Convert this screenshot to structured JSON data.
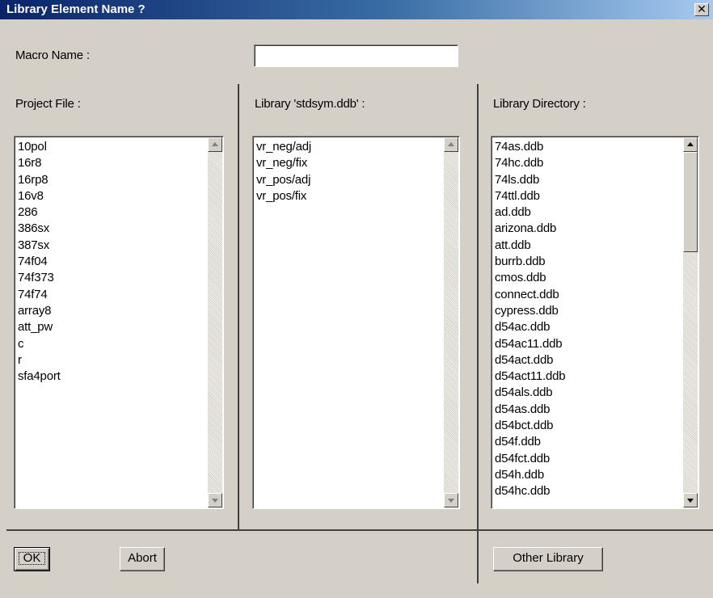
{
  "window": {
    "title": "Library Element Name ?",
    "close_symbol": "✕"
  },
  "macro": {
    "label": "Macro Name :",
    "value": "",
    "placeholder": ""
  },
  "project": {
    "label": "Project File :",
    "items": [
      "10pol",
      "16r8",
      "16rp8",
      "16v8",
      "286",
      "386sx",
      "387sx",
      "74f04",
      "74f373",
      "74f74",
      "array8",
      "att_pw",
      "c",
      "r",
      "sfa4port"
    ]
  },
  "library": {
    "label": "Library 'stdsym.ddb' :",
    "items": [
      "vr_neg/adj",
      "vr_neg/fix",
      "vr_pos/adj",
      "vr_pos/fix"
    ]
  },
  "directory": {
    "label": "Library Directory :",
    "items": [
      "74as.ddb",
      "74hc.ddb",
      "74ls.ddb",
      "74ttl.ddb",
      "ad.ddb",
      "arizona.ddb",
      "att.ddb",
      "burrb.ddb",
      "cmos.ddb",
      "connect.ddb",
      "cypress.ddb",
      "d54ac.ddb",
      "d54ac11.ddb",
      "d54act.ddb",
      "d54act11.ddb",
      "d54als.ddb",
      "d54as.ddb",
      "d54bct.ddb",
      "d54f.ddb",
      "d54fct.ddb",
      "d54h.ddb",
      "d54hc.ddb"
    ]
  },
  "buttons": {
    "ok": "OK",
    "abort": "Abort",
    "other_library": "Other Library"
  }
}
